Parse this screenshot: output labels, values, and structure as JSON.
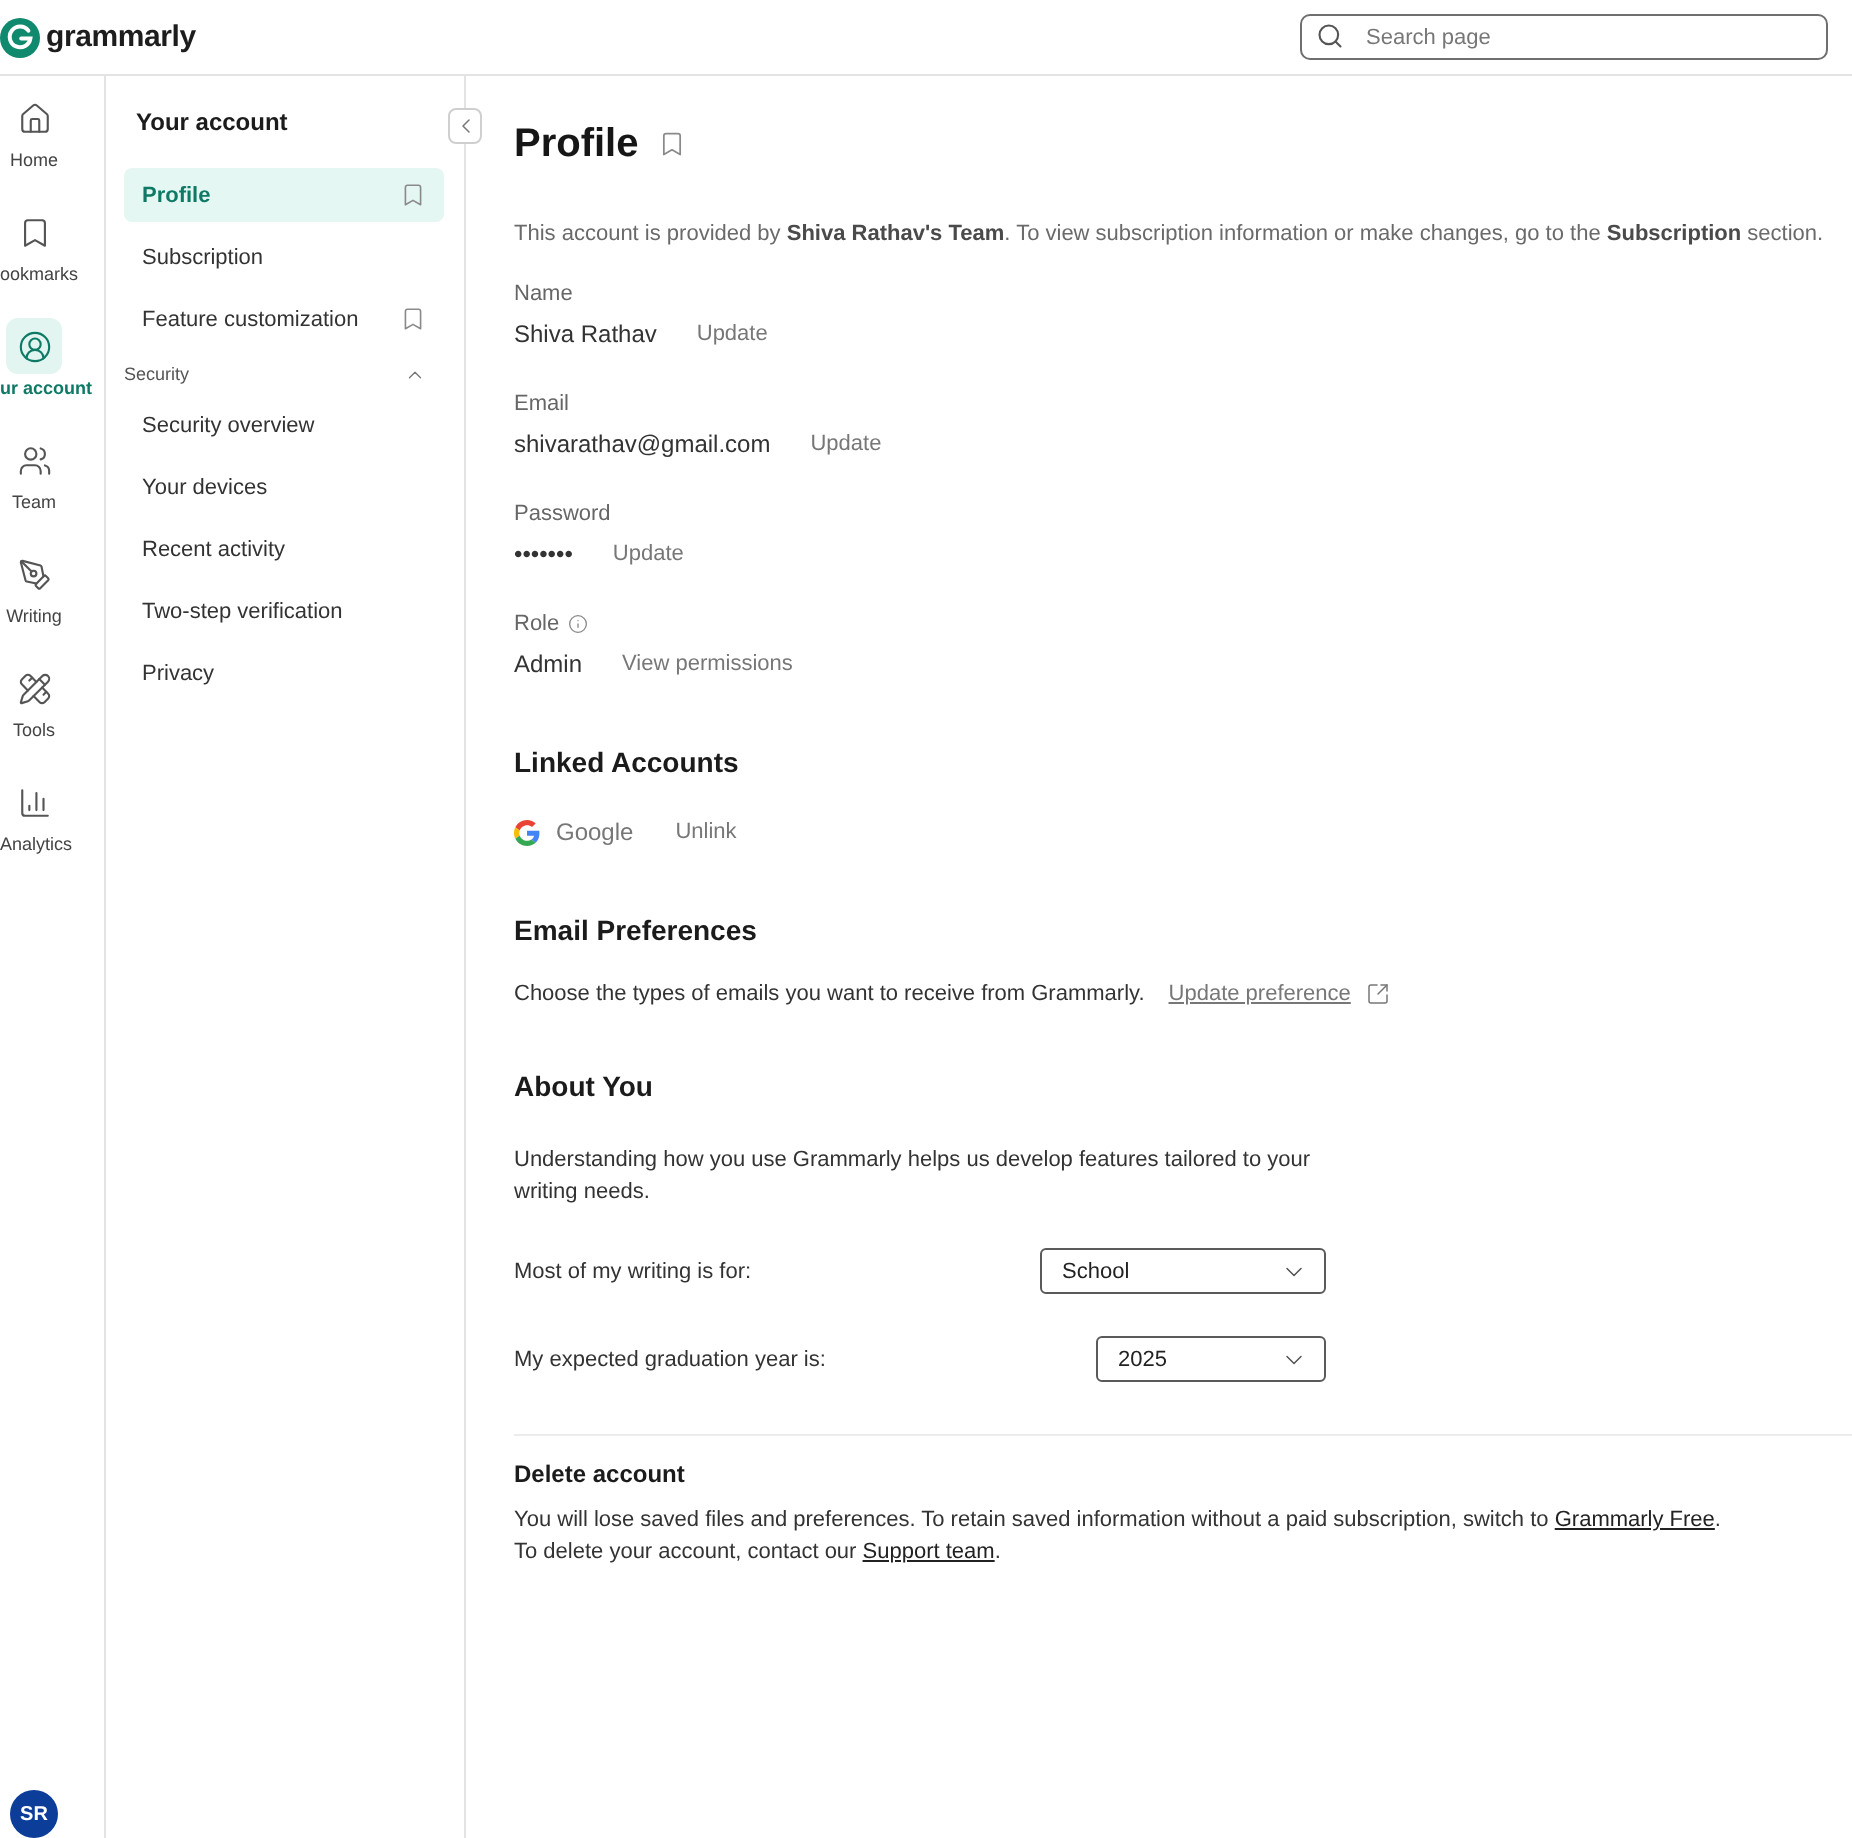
{
  "header": {
    "logo_text": "grammarly",
    "search": {
      "placeholder": "Search page"
    }
  },
  "rail": {
    "items": [
      {
        "label": "Home",
        "selected": false
      },
      {
        "label": "ookmarks",
        "selected": false
      },
      {
        "label": "ur account",
        "selected": true
      },
      {
        "label": "Team",
        "selected": false
      },
      {
        "label": "Writing",
        "selected": false
      },
      {
        "label": "Tools",
        "selected": false
      },
      {
        "label": "Analytics",
        "selected": false
      }
    ],
    "avatar": "SR"
  },
  "sidebar": {
    "title": "Your account",
    "items": [
      {
        "label": "Profile",
        "selected": true,
        "bookmark": true
      },
      {
        "label": "Subscription",
        "selected": false,
        "bookmark": false
      },
      {
        "label": "Feature customization",
        "selected": false,
        "bookmark": true
      }
    ],
    "sections": [
      {
        "label": "Security",
        "expanded": true,
        "items": [
          {
            "label": "Security overview",
            "selected": false
          },
          {
            "label": "Your devices",
            "selected": false
          },
          {
            "label": "Recent activity",
            "selected": false
          },
          {
            "label": "Two-step verification",
            "selected": false
          },
          {
            "label": "Privacy",
            "selected": false
          }
        ]
      }
    ]
  },
  "page": {
    "title": "Profile",
    "notice": "This account is provided by **Shiva Rathav's Team**. To view subscription information or make changes, go to the **Subscription** section.",
    "fields": [
      {
        "label": "Name",
        "value": "Shiva Rathav",
        "action": "Update",
        "info": false
      },
      {
        "label": "Email",
        "value": "shivarathav@gmail.com",
        "action": "Update",
        "info": false
      },
      {
        "label": "Password",
        "value": "•••••••",
        "action": "Update",
        "info": false
      },
      {
        "label": "Role",
        "value": "Admin",
        "action": "View permissions",
        "info": true
      }
    ]
  },
  "linked_accounts": {
    "heading": "Linked Accounts",
    "accounts": [
      {
        "name": "Google",
        "action": "Unlink"
      }
    ]
  },
  "email_preferences": {
    "heading": "Email Preferences",
    "text": "Choose the types of emails you want to receive from Grammarly.",
    "link": "Update preference"
  },
  "about_you": {
    "heading": "About You",
    "text": "Understanding how you use Grammarly helps us develop features tailored to your writing needs.",
    "questions": [
      {
        "label": "Most of my writing is for:",
        "value": "School"
      },
      {
        "label": "My expected graduation year is:",
        "value": "2025"
      }
    ]
  },
  "delete_account": {
    "heading": "Delete account",
    "lines": [
      {
        "text": "You will lose saved files and preferences. To retain saved information without a paid subscription, switch to",
        "link": "Grammarly Free",
        "after": "."
      },
      {
        "text": "To delete your account, contact our",
        "link": "Support team",
        "after": "."
      }
    ]
  }
}
